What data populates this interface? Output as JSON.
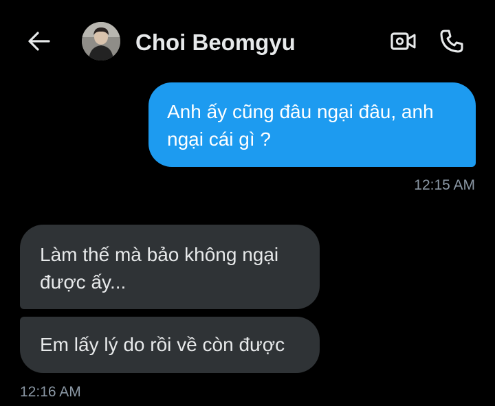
{
  "header": {
    "contact_name": "Choi Beomgyu",
    "back_icon": "arrow-left-icon",
    "video_icon": "video-camera-icon",
    "call_icon": "phone-icon"
  },
  "messages": [
    {
      "direction": "outgoing",
      "text": "Anh ấy cũng đâu ngại đâu, anh ngại cái gì ?",
      "time": "12:15 AM"
    },
    {
      "direction": "incoming",
      "text": "Làm thế mà bảo không ngại được ấy..."
    },
    {
      "direction": "incoming",
      "text": "Em lấy lý do rồi về còn được",
      "time": "12:16 AM"
    }
  ],
  "colors": {
    "background": "#000000",
    "outgoing_bubble": "#1d9bf0",
    "incoming_bubble": "#2f3336",
    "timestamp": "#8b98a5"
  }
}
